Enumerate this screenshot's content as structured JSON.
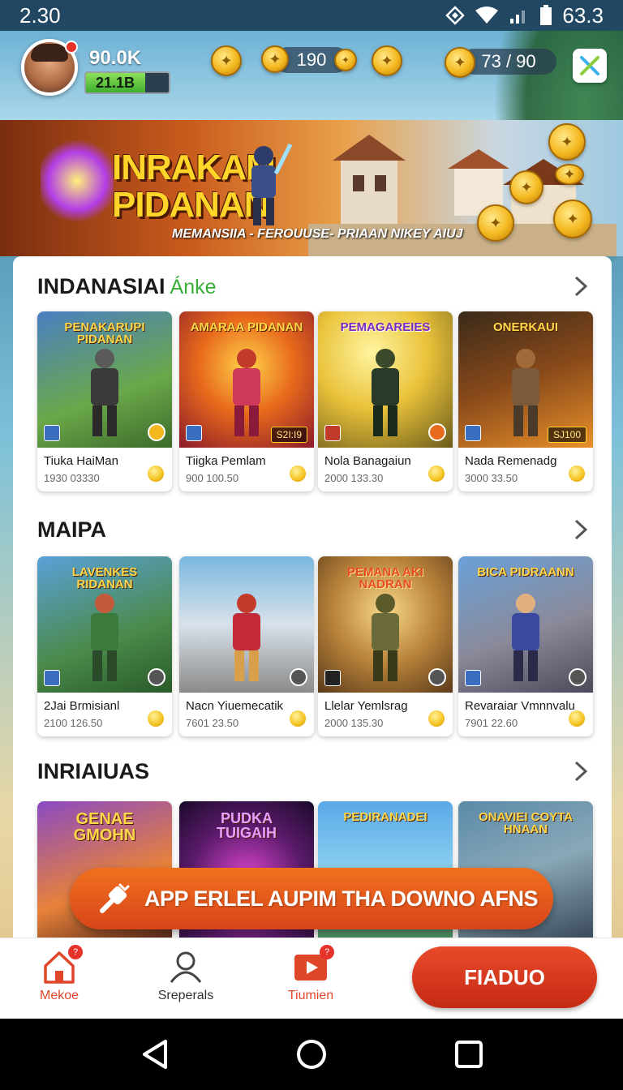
{
  "status_bar": {
    "time": "2.30",
    "battery": "63.3"
  },
  "player": {
    "level_label": "90.0K",
    "xp_label": "21.1B",
    "xp_progress": 0.72
  },
  "currency": {
    "gems_value": "190",
    "energy_value": "73 / 90"
  },
  "banner": {
    "title_line1": "INRAKAM",
    "title_line2": "PIDANAN",
    "subtitle": "MEMANSIIA - FEROUUSE- PRIAAN NIKEY AIUJ"
  },
  "sections": [
    {
      "title": "INDANASIAI",
      "accent": "Ánke",
      "cards": [
        {
          "art_title": "PENAKARUPI PIDANAN",
          "name": "Tiuka HaiMan",
          "stats": "1930 03330",
          "price": ""
        },
        {
          "art_title": "AMARAA PIDANAN",
          "name": "Tiigka Pemlam",
          "stats": "900 100.50",
          "price": "S2I:I9"
        },
        {
          "art_title": "PEMAGAREIES",
          "name": "Nola Banagaiun",
          "stats": "2000 133.30",
          "price": ""
        },
        {
          "art_title": "ONERKAUI",
          "name": "Nada Remenadg",
          "stats": "3000 33.50",
          "price": "SJ100"
        }
      ]
    },
    {
      "title": "MAIPA",
      "accent": "",
      "cards": [
        {
          "art_title": "LAVENKES RIDANAN",
          "name": "2Jai Brmisianl",
          "stats": "2100 126.50",
          "price": ""
        },
        {
          "art_title": "",
          "name": "Nacn Yiuemecatik",
          "stats": "7601 23.50",
          "price": ""
        },
        {
          "art_title": "PEMANA AKI NADRAN",
          "name": "Llelar Yemlsrag",
          "stats": "2000 135.30",
          "price": ""
        },
        {
          "art_title": "BICA PIDRAANN",
          "name": "Revaraiar Vmnnvalu",
          "stats": "7901 22.60",
          "price": ""
        }
      ]
    },
    {
      "title": "INRIAIUAS",
      "accent": "",
      "cards": [
        {
          "art_title": "GENAE GMOHN",
          "name": "",
          "stats": "",
          "price": ""
        },
        {
          "art_title": "PUDKA TUIGAIH",
          "name": "",
          "stats": "",
          "price": ""
        },
        {
          "art_title": "PEDIRANADEI",
          "name": "",
          "stats": "",
          "price": ""
        },
        {
          "art_title": "ONAVIEI COYTA HNAAN",
          "name": "",
          "stats": "",
          "price": ""
        }
      ]
    }
  ],
  "promo": {
    "text": "APP ERLEL AUPIM THA DOWNO AFNS"
  },
  "bottom_nav": {
    "home_label": "Mekoe",
    "home_badge": "?",
    "profile_label": "Sreperals",
    "video_label": "Tiumien",
    "video_badge": "?",
    "cta_label": "FIADUO"
  },
  "colors": {
    "accent_green": "#3aae3a",
    "cta_red": "#d8351c",
    "promo_orange": "#e85a1c",
    "coin_gold": "#f4b81f"
  }
}
